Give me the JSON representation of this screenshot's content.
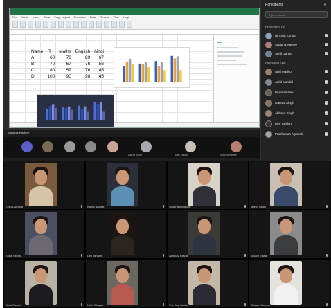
{
  "excel": {
    "ribbon_tabs": [
      "File",
      "Home",
      "Insert",
      "Draw",
      "Page Layout",
      "Formulas",
      "Data",
      "Review",
      "View",
      "Help"
    ],
    "table": {
      "headers": [
        "Name",
        "IT",
        "Maths",
        "English",
        "hindi"
      ],
      "rows": [
        [
          "A",
          "60",
          "78",
          "89",
          "67"
        ],
        [
          "B",
          "70",
          "67",
          "76",
          "56"
        ],
        [
          "C",
          "80",
          "59",
          "76",
          "45"
        ],
        [
          "D",
          "100",
          "90",
          "98",
          "45"
        ]
      ]
    },
    "chart1_bars": [
      [
        60,
        78,
        89,
        67
      ],
      [
        70,
        67,
        76,
        56
      ],
      [
        80,
        59,
        76,
        45
      ],
      [
        100,
        90,
        98,
        45
      ]
    ],
    "chart2_bars": [
      [
        60,
        78,
        89,
        67
      ],
      [
        70,
        67,
        76,
        56
      ],
      [
        80,
        59,
        76,
        45
      ],
      [
        100,
        90,
        98,
        45
      ]
    ]
  },
  "presenter": {
    "name": "Sapana Rathee"
  },
  "panel": {
    "title": "Participants",
    "close": "✕",
    "search_placeholder": "Type a name",
    "presenters_heading": "Presenters (3)",
    "attendees_heading": "Attendees (18)",
    "presenters": [
      "Nirmala Kumar",
      "Swapna Rathee",
      "Sunil Gardia"
    ],
    "attendees": [
      "Aditi Madhu",
      "Ankit Mandal",
      "Divya Hasani",
      "Gaurav Singh",
      "Abhaya Singh",
      "Dev Tandon",
      "Prabhanjan Agnivek"
    ]
  },
  "toolbar": {
    "labels": [
      "",
      "",
      "",
      "",
      "",
      "Aanya Singh",
      "Kavi Tandon",
      "",
      "Swapna Rathee"
    ]
  },
  "tiles": [
    {
      "name": "Ezilu Lakhotia",
      "video_color": "#7a5a3e",
      "shirt": "#d6c4a8"
    },
    {
      "name": "Nandi Bhagat",
      "video_color": "#2b2f3a",
      "shirt": "#5b8fb4"
    },
    {
      "name": "Shubham Mandal",
      "video_color": "#d9d2c9",
      "shirt": "#2f3038"
    },
    {
      "name": "Manvi Singh",
      "video_color": "#c9bfb2",
      "shirt": "#3a4a6a"
    },
    {
      "name": "Kunal Mishra",
      "video_color": "#4a4f62",
      "shirt": "#6c6a70"
    },
    {
      "name": "Dev Tandon",
      "video_color": "#1a1513",
      "shirt": "#2b2421"
    },
    {
      "name": "Abhinav Rawat",
      "video_color": "#3b3a37",
      "shirt": "#2e3340"
    },
    {
      "name": "Jayant Rawat",
      "video_color": "#8a8b8a",
      "shirt": "#3b3c3f"
    },
    {
      "name": "Ansh Rawat",
      "video_color": "#b8b2a7",
      "shirt": "#1c1c20"
    },
    {
      "name": "Nidhi Bhagat",
      "video_color": "#6b6761",
      "shirt": "#b85a4f"
    },
    {
      "name": "The Boy Sabka",
      "video_color": "#c4b8a8",
      "shirt": "#2b2b33"
    },
    {
      "name": "Shivam Saxena",
      "video_color": "#e4e2dd",
      "shirt": "#f2f2f2"
    }
  ]
}
